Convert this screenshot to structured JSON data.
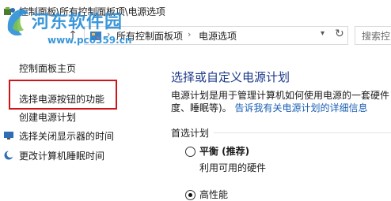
{
  "window": {
    "breadcrumb_title": "控制面板\\所有控制面板项\\电源选项"
  },
  "address_bar": {
    "separator": "›",
    "crumbs": [
      "所有控制面板项",
      "电源选项"
    ],
    "dropdown_icon": "chevron-down-icon",
    "refresh_icon": "refresh-icon",
    "up_icon": "up-arrow-icon",
    "search_placeholder": "搜索控"
  },
  "sidebar": {
    "home_label": "控制面板主页",
    "items": [
      {
        "label": "选择电源按钮的功能",
        "highlighted": true
      },
      {
        "label": "创建电源计划"
      },
      {
        "label": "选择关闭显示器的时间",
        "icon": "monitor-icon"
      },
      {
        "label": "更改计算机睡眠时间",
        "icon": "moon-icon"
      }
    ]
  },
  "main": {
    "title": "选择或自定义电源计划",
    "description_line1": "电源计划是用于管理计算机如何使用电源的一套硬件",
    "description_line2_prefix": "度、睡眠等)。",
    "description_link": "告诉我有关电源计划的详细信息",
    "preferred_plans_label": "首选计划",
    "plans": [
      {
        "name": "平衡 (推荐)",
        "description": "利用可用的硬件",
        "selected": false
      },
      {
        "name": "高性能",
        "selected": true
      }
    ]
  },
  "watermark": {
    "title": "河东软件园",
    "url": "www.pc0359.cn"
  },
  "colors": {
    "highlight_border": "#d0141b",
    "title_blue": "#1e3a8a",
    "link_blue": "#1a5fb4",
    "watermark_blue": "#2b8fd6"
  }
}
